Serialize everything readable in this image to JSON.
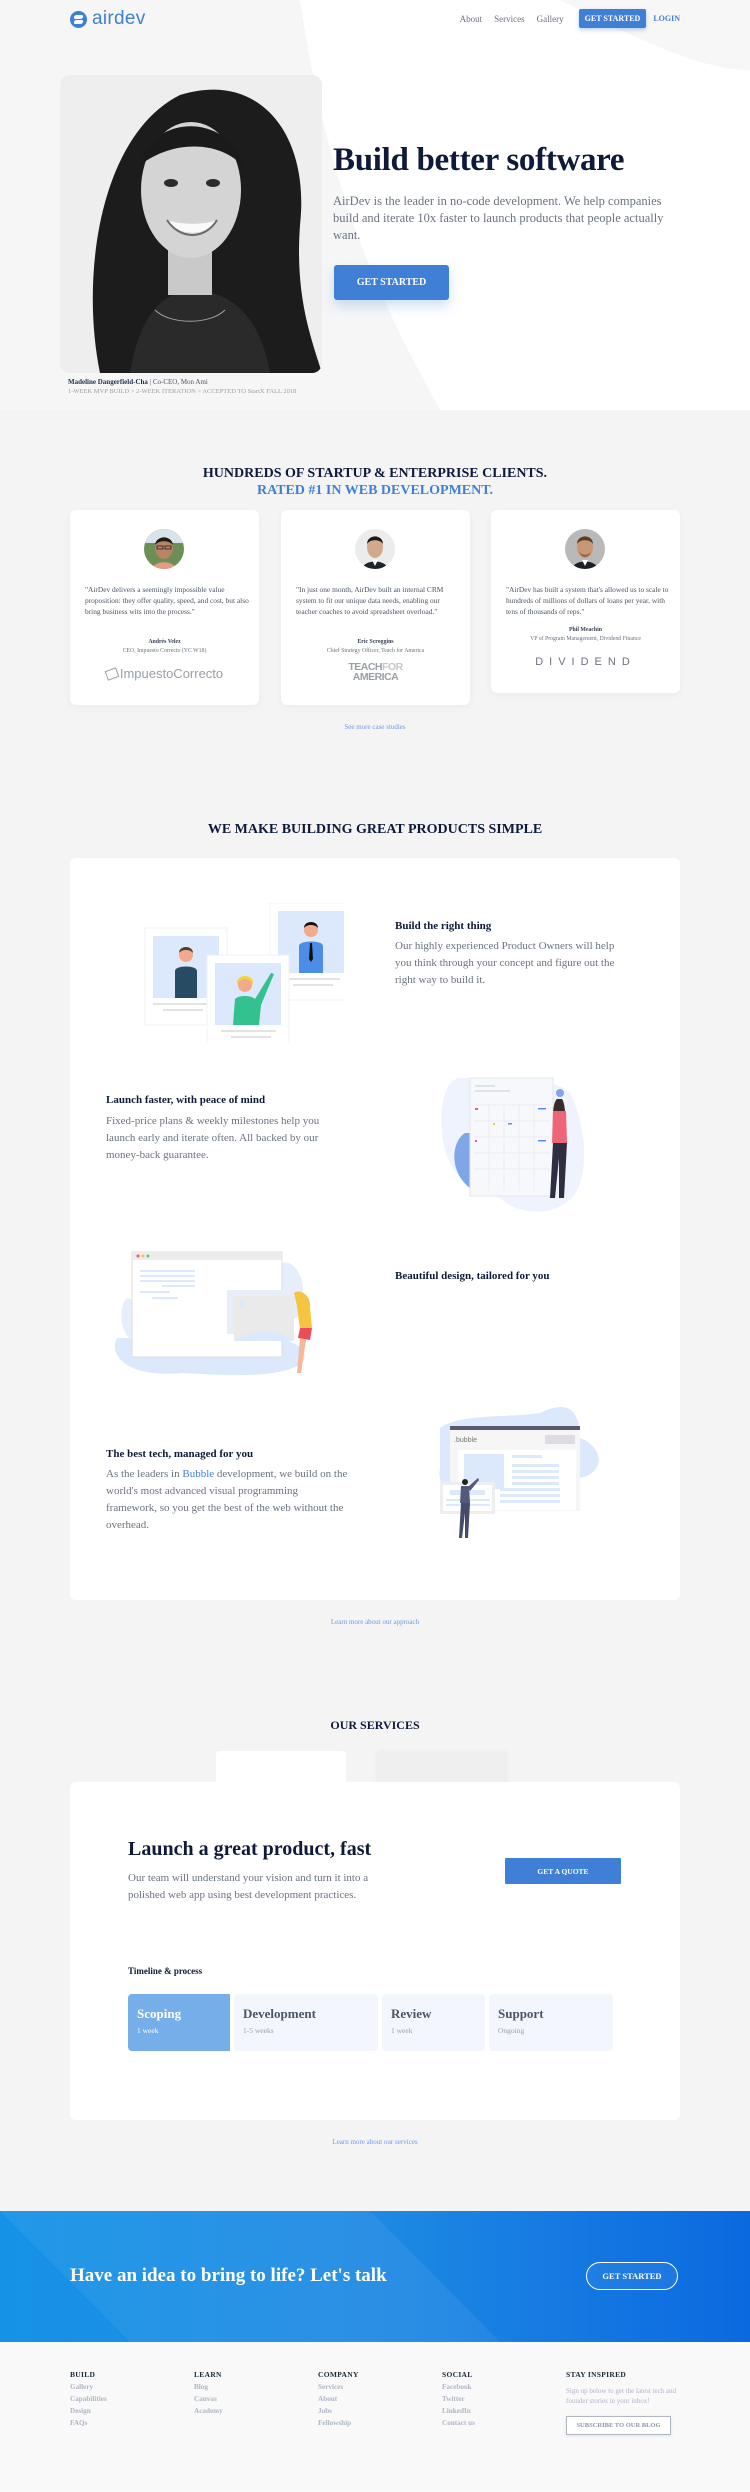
{
  "nav": {
    "logo_text": "airdev",
    "links": [
      "About",
      "Services",
      "Gallery"
    ],
    "cta_label": "GET STARTED",
    "login_label": "LOGIN"
  },
  "hero": {
    "title": "Build better software",
    "subtitle": "AirDev is the leader in no-code development. We help companies build and iterate 10x faster to launch products that people actually want.",
    "cta_label": "GET STARTED",
    "caption_name": "Madeline Dangerfield-Cha",
    "caption_separator": "|",
    "caption_role": "Co-CEO, Mon Ami",
    "caption_line2": "1-WEEK MVP BUILD > 2-WEEK ITERATION > ACCEPTED TO StartX FALL 2018"
  },
  "clients": {
    "title_line1": "HUNDREDS OF STARTUP & ENTERPRISE CLIENTS.",
    "title_line2": "RATED #1 IN WEB DEVELOPMENT.",
    "testimonials": [
      {
        "quote": "\"AirDev delivers a seemingly impossible value proposition: they offer quality, speed, and cost, but also bring business wits into the process.\"",
        "author": "Andrés Velez",
        "role": "CEO, Impuesto Correcto (YC W18)",
        "company_logo": "ImpuestoCorrecto"
      },
      {
        "quote": "\"In just one month, AirDev built an internal CRM system to fit our unique data needs, enabling our teacher coaches to avoid spreadsheet overload.\"",
        "author": "Eric Scroggins",
        "role": "Chief Strategy Officer, Teach for America",
        "company_logo_line1_a": "TEACH",
        "company_logo_line1_b": "FOR",
        "company_logo_line2": "AMERICA"
      },
      {
        "quote": "\"AirDev has built a system that's allowed us to scale to hundreds of millions of dollars of loans per year, with tens of thousands of reps.\"",
        "author": "Phil Meachin",
        "role": "VP of Program Management, Dividend Finance",
        "company_logo": "DIVIDEND"
      }
    ],
    "see_more": "See more case studies"
  },
  "simple": {
    "title": "WE MAKE BUILDING GREAT PRODUCTS SIMPLE",
    "features": [
      {
        "heading": "Build the right thing",
        "body": "Our highly experienced Product Owners will help you think through your concept and figure out the right way to build it."
      },
      {
        "heading": "Launch faster, with peace of mind",
        "body": "Fixed-price plans & weekly milestones help you launch early and iterate often. All backed by our money-back guarantee."
      },
      {
        "heading": "Beautiful design, tailored for you",
        "body": ""
      },
      {
        "heading": "The best tech, managed for you",
        "body_pre": "As the leaders in ",
        "body_link": "Bubble",
        "body_post": " development, we build on the world's most advanced visual programming framework, so you get the best of the web without the overhead."
      }
    ],
    "bubble_logo": ".bubble",
    "learn_more": "Learn more about our approach"
  },
  "services": {
    "title": "OUR SERVICES",
    "card_title": "Launch a great product, fast",
    "card_body": "Our team will understand your vision and turn it into a polished web app using best development practices.",
    "quote_label": "GET A QUOTE",
    "timeline_label": "Timeline & process",
    "timeline": [
      {
        "name": "Scoping",
        "duration": "1 week",
        "active": true
      },
      {
        "name": "Development",
        "duration": "1-5 weeks",
        "active": false
      },
      {
        "name": "Review",
        "duration": "1 week",
        "active": false
      },
      {
        "name": "Support",
        "duration": "Ongoing",
        "active": false
      }
    ],
    "learn_more": "Learn more about our services"
  },
  "cta": {
    "text": "Have an idea to bring to life? Let's talk",
    "button": "GET STARTED"
  },
  "footer": {
    "columns": [
      {
        "heading": "BUILD",
        "links": [
          "Gallery",
          "Capabilities",
          "Design",
          "FAQs"
        ]
      },
      {
        "heading": "LEARN",
        "links": [
          "Blog",
          "Canvas",
          "Academy"
        ]
      },
      {
        "heading": "COMPANY",
        "links": [
          "Services",
          "About",
          "Jobs",
          "Fellowship"
        ]
      },
      {
        "heading": "SOCIAL",
        "links": [
          "Facebook",
          "Twitter",
          "LinkedIn",
          "Contact us"
        ]
      }
    ],
    "inspired_heading": "STAY INSPIRED",
    "inspired_text": "Sign up below to get the latest tech and founder stories in your inbox!",
    "subscribe_label": "SUBSCRIBE TO OUR BLOG"
  },
  "colors": {
    "brand_blue": "#3f7fd6",
    "navy": "#0f1a3a",
    "timeline_active": "#76aeea",
    "page_bg": "#f4f4f4"
  }
}
